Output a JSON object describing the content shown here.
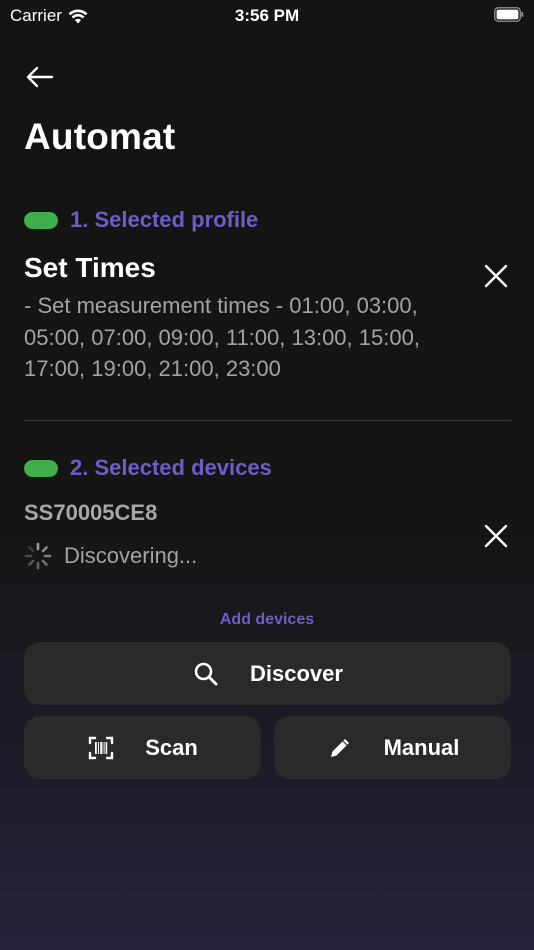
{
  "status_bar": {
    "carrier": "Carrier",
    "time": "3:56 PM"
  },
  "header": {
    "back_icon": "arrow-left-icon",
    "title": "Automat"
  },
  "profile_section": {
    "label": "1. Selected profile",
    "indicator_color": "#3fae4c",
    "profile_name": "Set Times",
    "profile_description": "- Set measurement times - 01:00, 03:00, 05:00, 07:00, 09:00, 11:00, 13:00, 15:00, 17:00, 19:00, 21:00, 23:00",
    "remove_icon": "close-icon"
  },
  "devices_section": {
    "label": "2. Selected devices",
    "indicator_color": "#3fae4c",
    "device_id": "SS70005CE8",
    "device_status": "Discovering...",
    "remove_icon": "close-icon"
  },
  "add_devices": {
    "label": "Add devices",
    "discover_label": "Discover",
    "scan_label": "Scan",
    "manual_label": "Manual"
  },
  "colors": {
    "accent": "#6b5fc4",
    "indicator": "#3fae4c",
    "button_bg": "#2a2a2a"
  }
}
